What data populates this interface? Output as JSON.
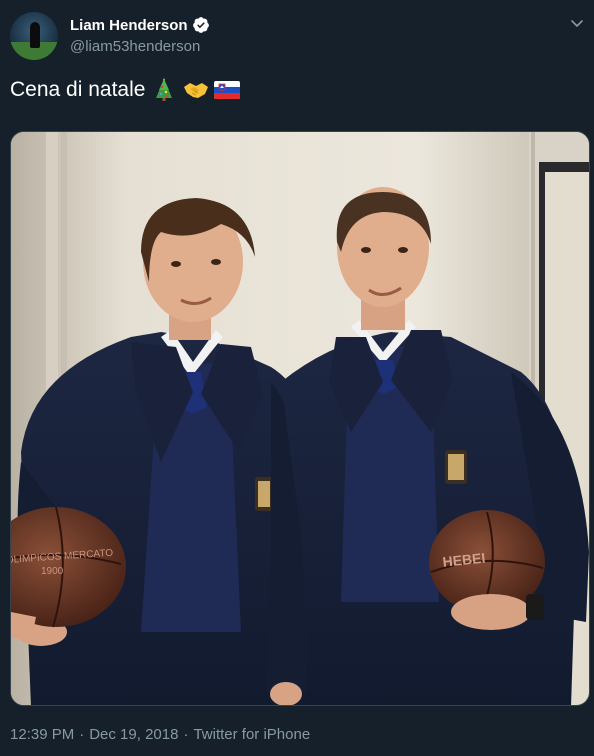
{
  "user": {
    "display_name": "Liam Henderson",
    "handle": "@liam53henderson",
    "verified": true
  },
  "tweet": {
    "text": "Cena di natale",
    "emojis": [
      "christmas-tree",
      "handshake",
      "flag-slovenia"
    ]
  },
  "photo": {
    "ball_left_text": "OLIMPICOS MERCATO\n1900",
    "ball_right_text": "HEBEI"
  },
  "meta": {
    "time": "12:39 PM",
    "date": "Dec 19, 2018",
    "source": "Twitter for iPhone"
  },
  "colors": {
    "background": "#15202b",
    "secondary_text": "#8899a6",
    "verified_blue": "#1da1f2",
    "border": "#38444d"
  }
}
